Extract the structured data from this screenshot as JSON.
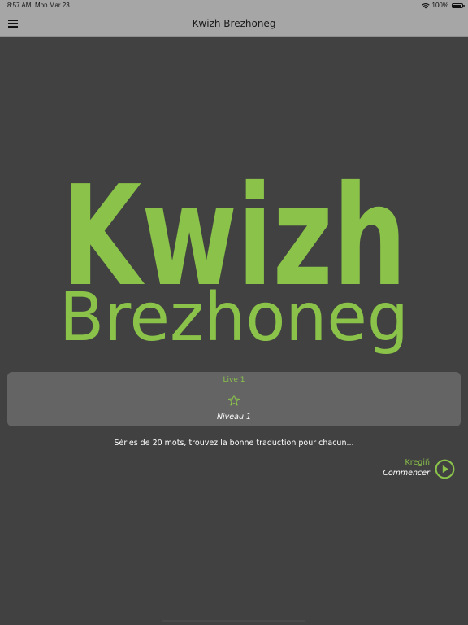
{
  "status_bar": {
    "time": "8:57 AM",
    "date": "Mon Mar 23",
    "battery": "100%"
  },
  "nav_bar": {
    "title": "Kwizh Brezhoneg",
    "menu_icon": "hamburger-menu-icon"
  },
  "logo": {
    "line1": "Kwizh",
    "line2": "Brezhoneg",
    "color": "#8ac24a"
  },
  "level_card": {
    "level_label": "Live 1",
    "star_icon": "star-outline-icon",
    "level_subtitle": "Niveau 1"
  },
  "description": "Séries de 20 mots, trouvez la bonne traduction pour chacun...",
  "start": {
    "primary_label": "Kregiñ",
    "secondary_label": "Commencer",
    "icon": "play-circle-icon"
  },
  "colors": {
    "background": "#414141",
    "bar": "#a6a6a6",
    "card": "#646464",
    "accent": "#8ac24a"
  }
}
